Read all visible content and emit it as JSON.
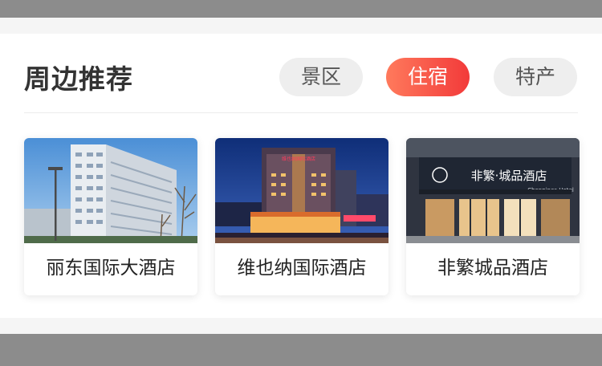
{
  "section": {
    "title": "周边推荐",
    "tabs": [
      {
        "label": "景区",
        "active": false
      },
      {
        "label": "住宿",
        "active": true
      },
      {
        "label": "特产",
        "active": false
      }
    ]
  },
  "hotels": [
    {
      "name": "丽东国际大酒店"
    },
    {
      "name": "维也纳国际酒店",
      "sign": "维也纳国际酒店"
    },
    {
      "name": "非繁城品酒店",
      "sign": "非繁·城品酒店",
      "sign_en": "Chonpines Hotel"
    }
  ],
  "colors": {
    "accent_start": "#ff7a5c",
    "accent_end": "#f23a3a",
    "tab_bg": "#eeeeee",
    "title": "#333333"
  }
}
